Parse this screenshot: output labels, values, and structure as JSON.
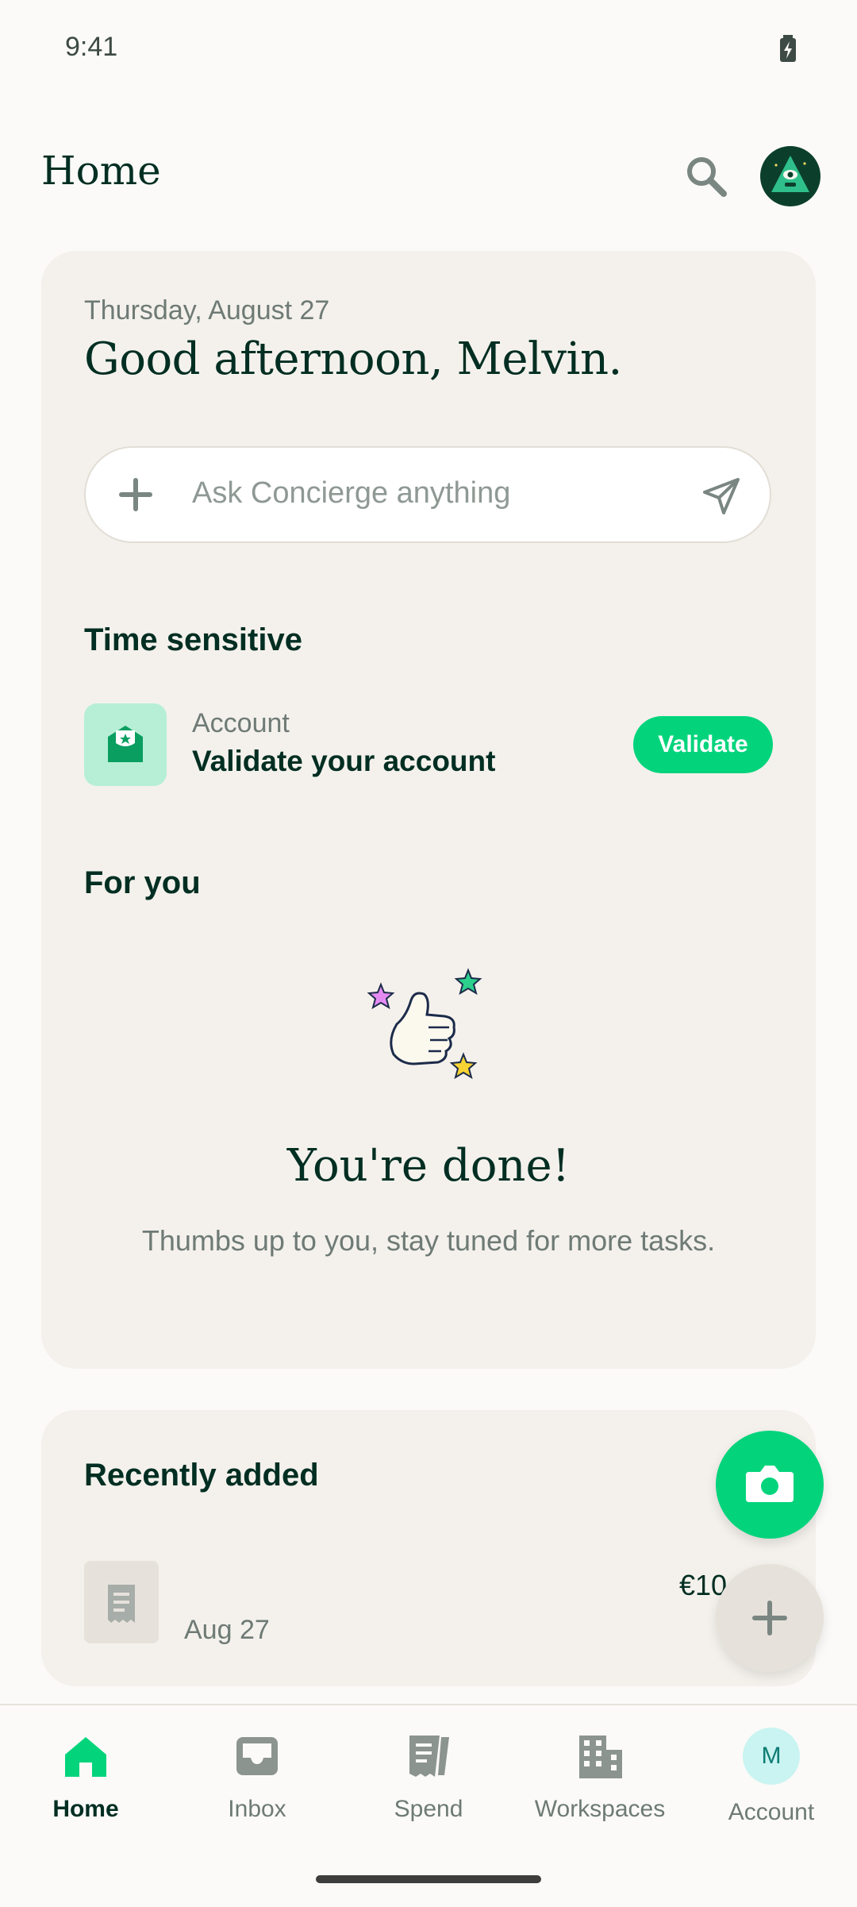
{
  "status_bar": {
    "time": "9:41"
  },
  "header": {
    "title": "Home"
  },
  "greeting_card": {
    "date": "Thursday, August 27",
    "greeting": "Good afternoon, Melvin.",
    "ask_placeholder": "Ask Concierge anything",
    "time_sensitive": {
      "title": "Time sensitive",
      "item": {
        "category": "Account",
        "title": "Validate your account",
        "action_label": "Validate"
      }
    },
    "for_you": {
      "title": "For you",
      "done_title": "You're done!",
      "done_subtitle": "Thumbs up to you, stay tuned for more tasks."
    }
  },
  "recently_added": {
    "title": "Recently added",
    "items": [
      {
        "date": "Aug 27",
        "amount": "€10"
      }
    ]
  },
  "bottom_nav": {
    "items": [
      {
        "label": "Home",
        "icon": "home-icon",
        "active": true
      },
      {
        "label": "Inbox",
        "icon": "inbox-icon"
      },
      {
        "label": "Spend",
        "icon": "receipt-icon"
      },
      {
        "label": "Workspaces",
        "icon": "building-icon"
      },
      {
        "label": "Account",
        "icon": "account-avatar",
        "initial": "M"
      }
    ]
  },
  "colors": {
    "accent_green": "#03D47C",
    "text_dark": "#002E22",
    "muted": "#6E7A75",
    "card_bg": "#F4F1EC"
  }
}
